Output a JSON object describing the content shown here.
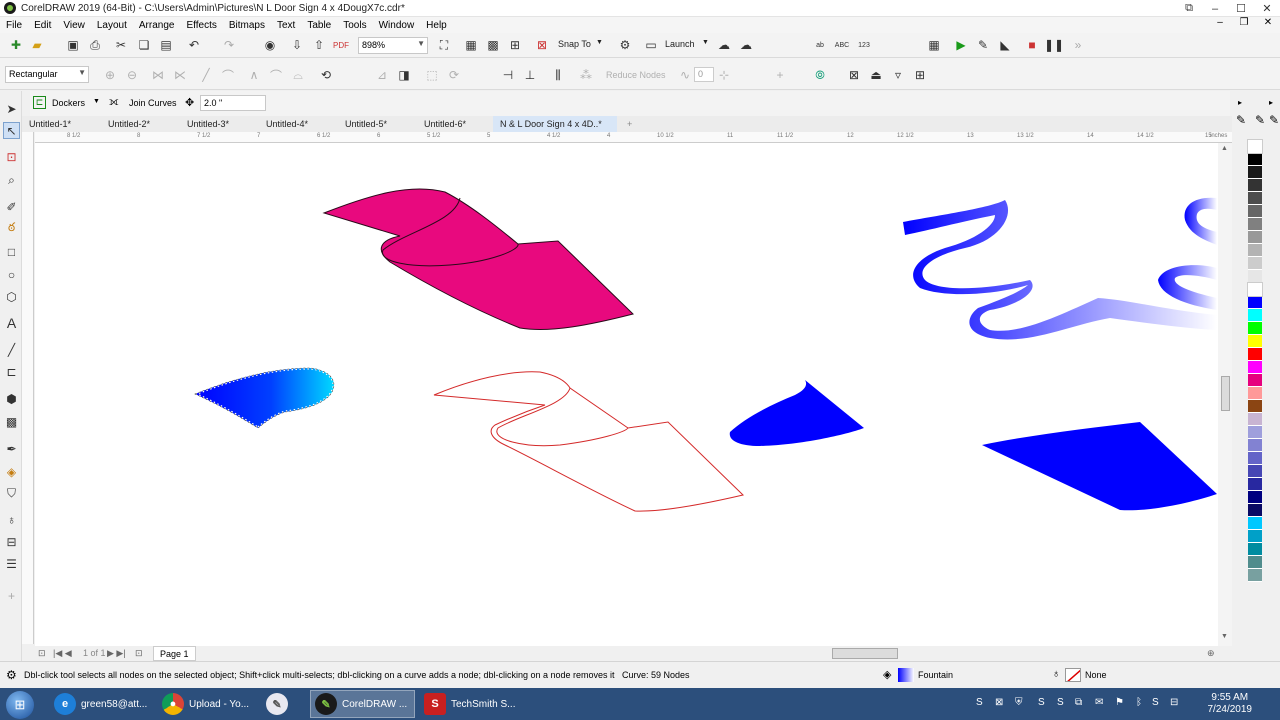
{
  "titlebar": {
    "title": "CorelDRAW 2019 (64-Bit) - C:\\Users\\Admin\\Pictures\\N  L Door Sign 4 x 4DougX7c.cdr*"
  },
  "menu": [
    "File",
    "Edit",
    "View",
    "Layout",
    "Arrange",
    "Effects",
    "Bitmaps",
    "Text",
    "Table",
    "Tools",
    "Window",
    "Help"
  ],
  "toolbar": {
    "zoom": "898%",
    "snap_to": "Snap To",
    "launch": "Launch"
  },
  "propbar": {
    "shape_mode": "Rectangular",
    "reduce_nodes": "Reduce Nodes",
    "smoothness": "0"
  },
  "dockbar": {
    "dockers": "Dockers",
    "join_curves": "Join Curves",
    "join_distance": "2.0 \""
  },
  "tabs": [
    "Untitled-1*",
    "Untitled-2*",
    "Untitled-3*",
    "Untitled-4*",
    "Untitled-5*",
    "Untitled-6*",
    "N & L Door Sign 4 x 4D..*"
  ],
  "ruler": {
    "labels": [
      "8 1/2",
      "8",
      "7 1/2",
      "7",
      "6 1/2",
      "6",
      "5 1/2",
      "5",
      "4 1/2",
      "4",
      "10 1/2",
      "11",
      "11 1/2",
      "12",
      "12 1/2",
      "13",
      "13 1/2",
      "14",
      "14 1/2",
      "15"
    ],
    "unit": "inches"
  },
  "pages": {
    "label": "Page 1",
    "pager": "1  of  1"
  },
  "status": {
    "hint": "Dbl-click tool selects all nodes on the selected object; Shift+click multi-selects; dbl-clicking on a curve adds a node; dbl-clicking on a node removes it",
    "curve": "Curve: 59 Nodes",
    "fill": "Fountain",
    "outline": "None"
  },
  "taskbar": {
    "items": [
      "green58@att...",
      "Upload - Yo...",
      "",
      "CorelDRAW ...",
      "TechSmith S..."
    ],
    "time": "9:55 AM",
    "date": "7/24/2019"
  },
  "colors": {
    "magenta": "#e8097e",
    "blue": "#0000ff",
    "outline_red": "#d42a2a",
    "taskbar": "#2c4f7c"
  },
  "palette": [
    "#ffffff",
    "#000000",
    "#1a1a1a",
    "#333333",
    "#4d4d4d",
    "#666666",
    "#808080",
    "#999999",
    "#b3b3b3",
    "#cccccc",
    "#e6e6e6",
    "#ffffff",
    "#0000ff",
    "#00ffff",
    "#00ff00",
    "#ffff00",
    "#ff0000",
    "#ff00ff",
    "#e6007e",
    "#ff9999",
    "#8b4513",
    "#c8b4d2",
    "#9f9fdc",
    "#8282d2",
    "#6464c8",
    "#4646b4",
    "#2828a0",
    "#000080",
    "#0a0a64",
    "#00c8ff",
    "#00a0c8",
    "#008ca0",
    "#508c8c",
    "#78a0a0"
  ]
}
